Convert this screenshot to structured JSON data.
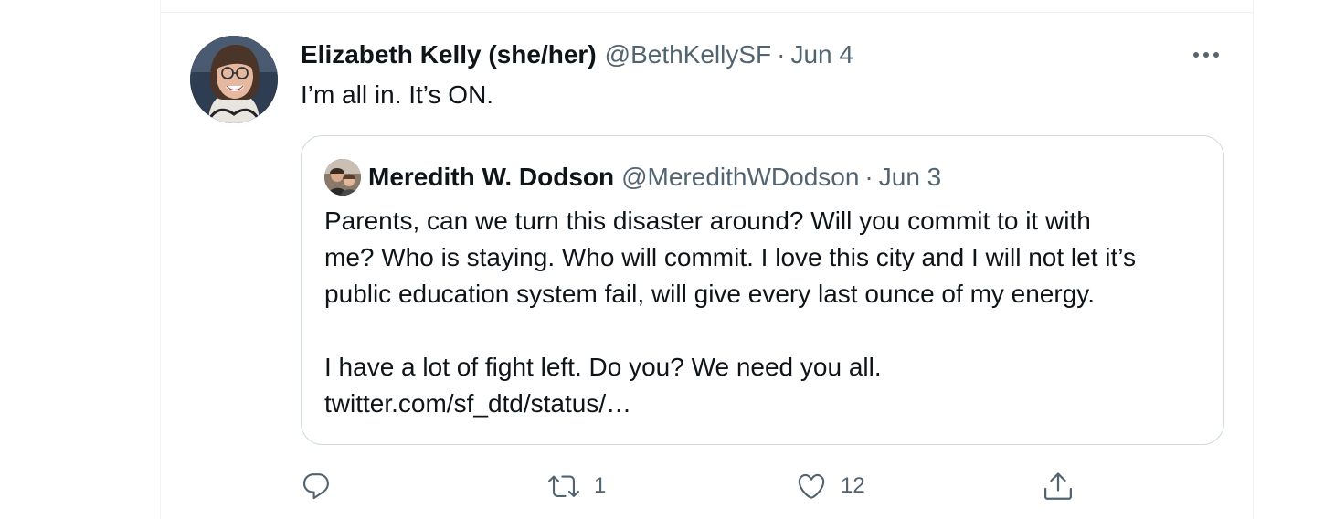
{
  "tweet": {
    "author": {
      "display_name": "Elizabeth Kelly (she/her)",
      "handle": "@BethKellySF"
    },
    "separator": "·",
    "date": "Jun 4",
    "text": "I’m all in. It’s ON.",
    "more_icon": "more-horizontal-icon"
  },
  "quoted_tweet": {
    "author": {
      "display_name": "Meredith W. Dodson",
      "handle": "@MeredithWDodson"
    },
    "separator": "·",
    "date": "Jun 3",
    "lines": [
      "Parents, can we turn this disaster around? Will you commit to it with",
      "me? Who is staying. Who will commit. I love this city and I will not let it’s",
      "public education system fail, will give every last ounce of my energy.",
      "I have a lot of fight left. Do you? We need you all.",
      "twitter.com/sf_dtd/status/…"
    ]
  },
  "actions": {
    "reply": {
      "icon": "reply-icon",
      "count": ""
    },
    "retweet": {
      "icon": "retweet-icon",
      "count": "1"
    },
    "like": {
      "icon": "heart-icon",
      "count": "12"
    },
    "share": {
      "icon": "share-icon"
    }
  },
  "colors": {
    "text_primary": "#0f1419",
    "text_secondary": "#536471",
    "border": "#cfd9de",
    "divider": "#eff3f4"
  }
}
